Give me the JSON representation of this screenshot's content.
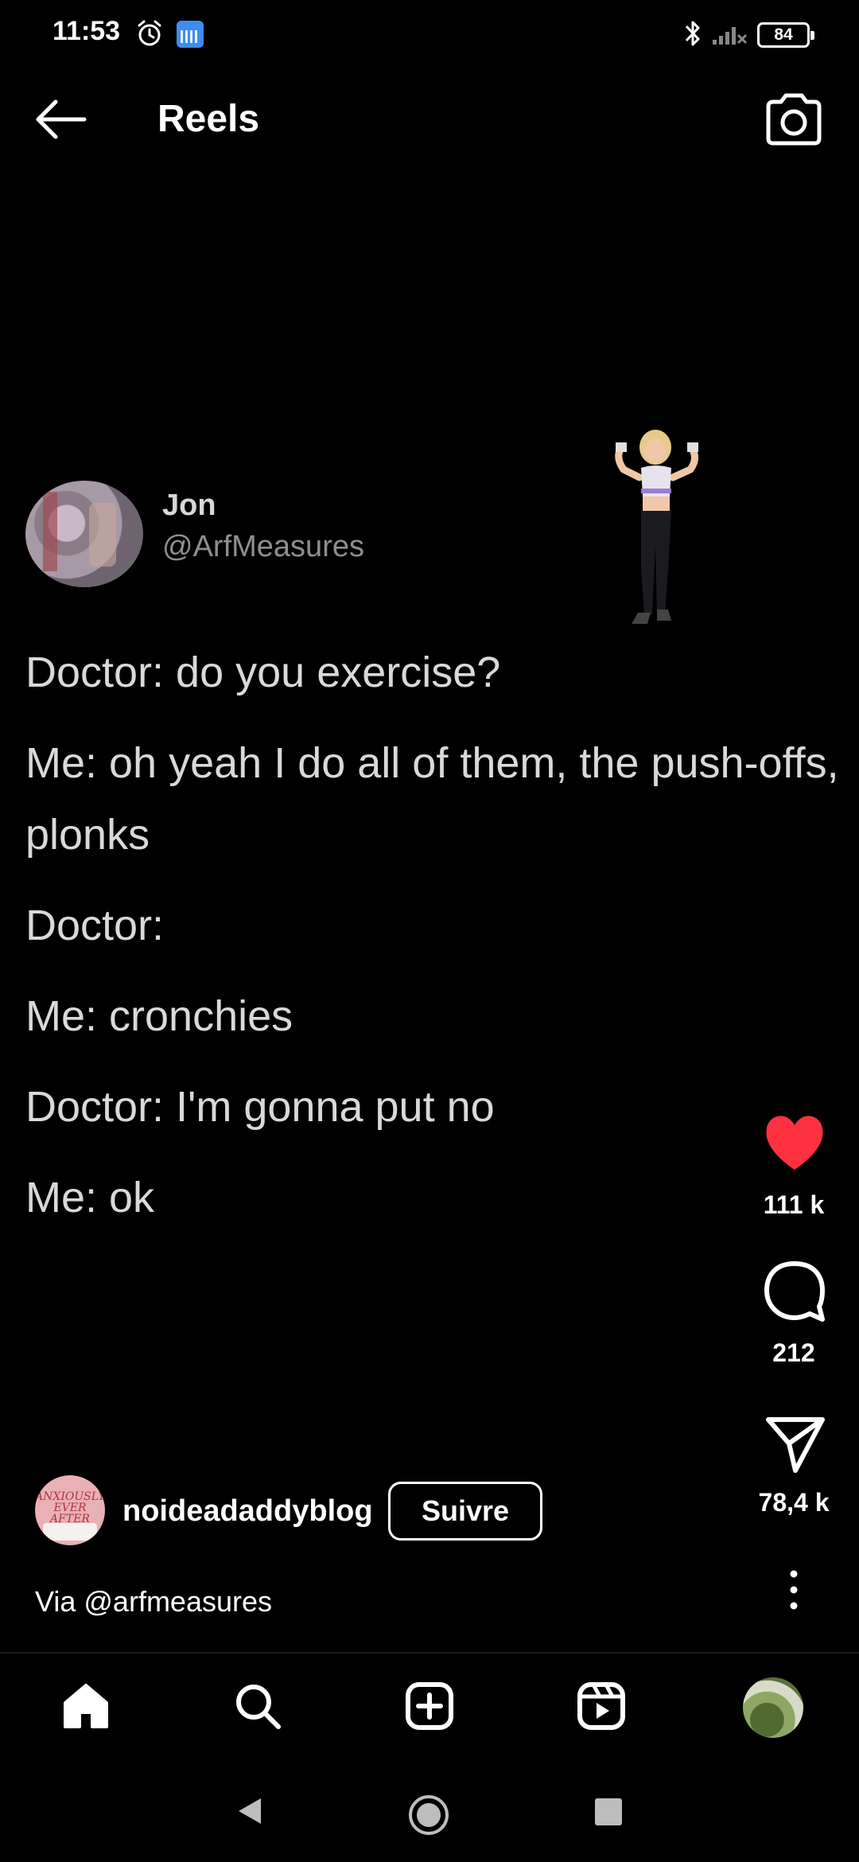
{
  "status_bar": {
    "time": "11:53",
    "battery": "84",
    "icons": [
      "alarm-icon",
      "calendar-icon",
      "bluetooth-icon",
      "signal-icon",
      "battery-icon"
    ]
  },
  "header": {
    "title": "Reels",
    "back_icon": "arrow-left-icon",
    "camera_icon": "camera-icon"
  },
  "post": {
    "tweet_name": "Jon",
    "tweet_handle": "@ArfMeasures",
    "lines": [
      "Doctor: do you exercise?",
      "Me: oh yeah I do all of them, the push-offs, plonks",
      "Doctor:",
      "Me: cronchies",
      "Doctor: I'm gonna put no",
      "Me: ok"
    ]
  },
  "actions": {
    "like_count": "111 k",
    "comment_count": "212",
    "share_count": "78,4 k",
    "like_color": "#ff3040"
  },
  "author": {
    "avatar_text": "ANXIOUSLY EVER AFTER",
    "username": "noideadaddyblog",
    "follow_label": "Suivre",
    "caption": "Via @arfmeasures"
  },
  "bottom_nav": [
    "home-icon",
    "search-icon",
    "create-icon",
    "reels-icon",
    "profile-avatar"
  ],
  "system_nav": [
    "back-triangle",
    "home-circle",
    "recents-square"
  ]
}
